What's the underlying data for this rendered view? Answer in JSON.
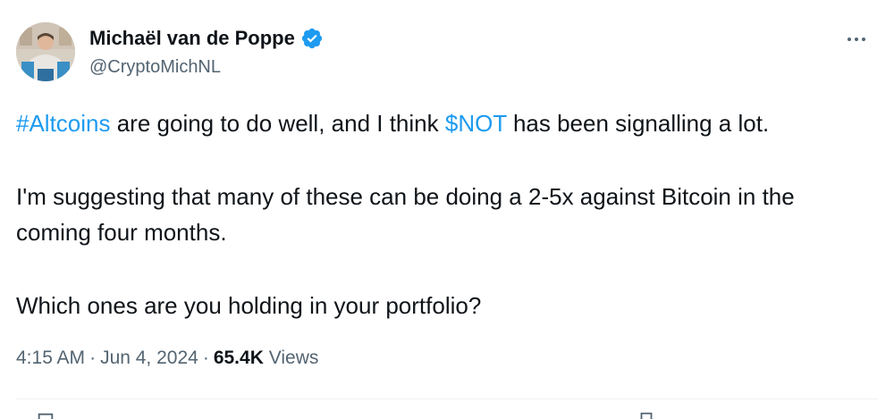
{
  "tweet": {
    "author": {
      "display_name": "Michaël van de Poppe",
      "handle": "@CryptoMichNL",
      "verified_icon": "verified-badge-icon",
      "avatar": "avatar-photo"
    },
    "more_icon": "more-options-icon",
    "body": {
      "line1_hashtag": "#Altcoins",
      "line1_mid": " are going to do well, and I think ",
      "line1_cashtag": "$NOT",
      "line1_end": " has been signalling a lot.",
      "paragraph2": "I'm suggesting that many of these can be doing a 2-5x against Bitcoin in the coming four months.",
      "paragraph3": "Which ones are you holding in your portfolio?"
    },
    "meta": {
      "time": "4:15 AM",
      "dot": "·",
      "date": "Jun 4, 2024",
      "views_count": "65.4K",
      "views_label": "Views"
    },
    "colors": {
      "link": "#1d9bf0",
      "secondary_text": "#536471",
      "primary_text": "#0f1419",
      "divider": "#eff3f4"
    }
  }
}
